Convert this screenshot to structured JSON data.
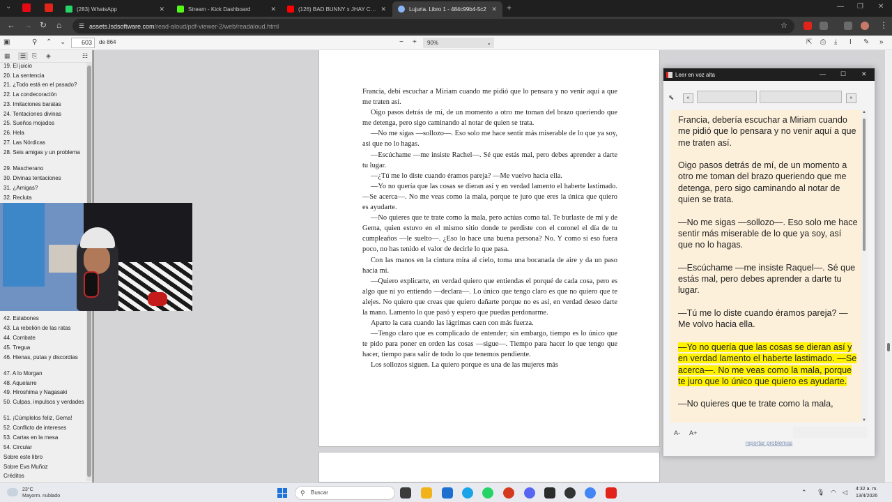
{
  "browser": {
    "tabs": [
      {
        "title": "(283) WhatsApp",
        "color": "#25d366"
      },
      {
        "title": "Stream - Kick Dashboard",
        "color": "#53fc18"
      },
      {
        "title": "(126) BAD BUNNY x JHAY CORTEZ",
        "color": "#ff0000"
      },
      {
        "title": "Lujuria. Libro 1 - 484c99b4-5c2",
        "color": "#8ab4f8"
      }
    ],
    "url_host": "assets.lsdsoftware.com",
    "url_path": "/read-aloud/pdf-viewer-2/web/readaloud.html"
  },
  "pdf_toolbar": {
    "page_number": "603",
    "page_count": "de 864",
    "zoom": "90%"
  },
  "outline_top": [
    "19. El juicio",
    "20. La sentencia",
    "21. ¿Todo está en el pasado?",
    "22. La condecoración",
    "23. Imitaciones baratas",
    "24. Tentaciones divinas",
    "25. Sueños mojados",
    "26. Hela",
    "27. Las Nórdicas",
    "28. Seis amigas y un problema",
    "29. Mascherano",
    "30. Divinas tentaciones",
    "31. ¿Amigas?",
    "32. Recluta"
  ],
  "outline_bottom": [
    "42. Eslabones",
    "43. La rebelión de las ratas",
    "44. Combate",
    "45. Tregua",
    "46. Hienas, putas y discordias",
    "47. A lo Morgan",
    "48. Aquelarre",
    "49. Hiroshima y Nagasaki",
    "50. Culpas, impulsos y verdades",
    "51. ¡Cúmplelos feliz, Gema!",
    "52. Conflicto de intereses",
    "53. Cartas en la mesa",
    "54. Circular",
    "Sobre este libro",
    "Sobre Eva Muñoz",
    "Créditos"
  ],
  "page_paragraphs": [
    "Francia, debí escuchar a Miriam cuando me pidió que lo pensara y no venir aquí a que me traten así.",
    "Oigo pasos detrás de mí, de un momento a otro me toman del brazo queriendo que me detenga, pero sigo caminando al notar de quien se trata.",
    "—No me sigas —sollozo—. Eso solo me hace sentir más miserable de lo que ya soy, así que no lo hagas.",
    "—Escúchame —me insiste Rachel—. Sé que estás mal, pero debes aprender a darte tu lugar.",
    "—¿Tú me lo diste cuando éramos pareja? —Me vuelvo hacia ella.",
    "—Yo no quería que las cosas se dieran así y en verdad lamento el haberte lastimado. —Se acerca—. No me veas como la mala, porque te juro que eres la única que quiero es ayudarte.",
    "—No quieres que te trate como la mala, pero actúas como tal. Te burlaste de mí y de Gema, quien estuvo en el mismo sitio donde te perdiste con el coronel el día de tu cumpleaños —le suelto—. ¿Eso lo hace una buena persona? No. Y como si eso fuera poco, no has tenido el valor de decirle lo que pasa.",
    "Con las manos en la cintura mira al cielo, toma una bocanada de aire y da un paso hacia mí.",
    "—Quiero explicarte, en verdad quiero que entiendas el porqué de cada cosa, pero es algo que ni yo entiendo —declara—. Lo único que tengo claro es que no quiero que te alejes. No quiero que creas que quiero dañarte porque no es así, en verdad deseo darte la mano. Lamento lo que pasó y espero que puedas perdonarme.",
    "Aparto la cara cuando las lágrimas caen con más fuerza.",
    "—Tengo claro que es complicado de entender; sin embargo, tiempo es lo único que te pido para poner en orden las cosas —sigue—. Tiempo para hacer lo que tengo que hacer, tiempo para salir de todo lo que tenemos pendiente.",
    "Los sollozos siguen. La quiero porque es una de las mujeres más"
  ],
  "read_aloud": {
    "title": "Leer en voz alta",
    "prev": "«",
    "next": "»",
    "paragraphs": [
      "Francia, debería escuchar a Miriam cuando me pidió que lo pensara y no venir aquí a que me traten así.",
      "Oigo pasos detrás de mí, de un momento a otro me toman del brazo queriendo que me detenga, pero sigo caminando al notar de quien se trata.",
      "—No me sigas —sollozo—. Eso solo me hace sentir más miserable de lo que ya soy, así que no lo hagas.",
      "—Escúchame —me insiste Raquel—. Sé que estás mal, pero debes aprender a darte tu lugar.",
      "—Tú me lo diste cuando éramos pareja? —Me volvo hacia ella.",
      "—No quieres que te trate como la mala,"
    ],
    "highlighted": "—Yo no quería que las cosas se dieran así y en verdad lamento el haberte lastimado. —Se acerca—. No me veas como la mala, porque te juro que lo único que quiero es ayudarte.",
    "font_decrease": "A-",
    "font_increase": "A+",
    "report": "reportar problemas"
  },
  "taskbar": {
    "temp": "23°C",
    "weather": "Mayorm. nublado",
    "search": "Buscar",
    "time": "4:32 a. m.",
    "date": "13/4/2026"
  }
}
